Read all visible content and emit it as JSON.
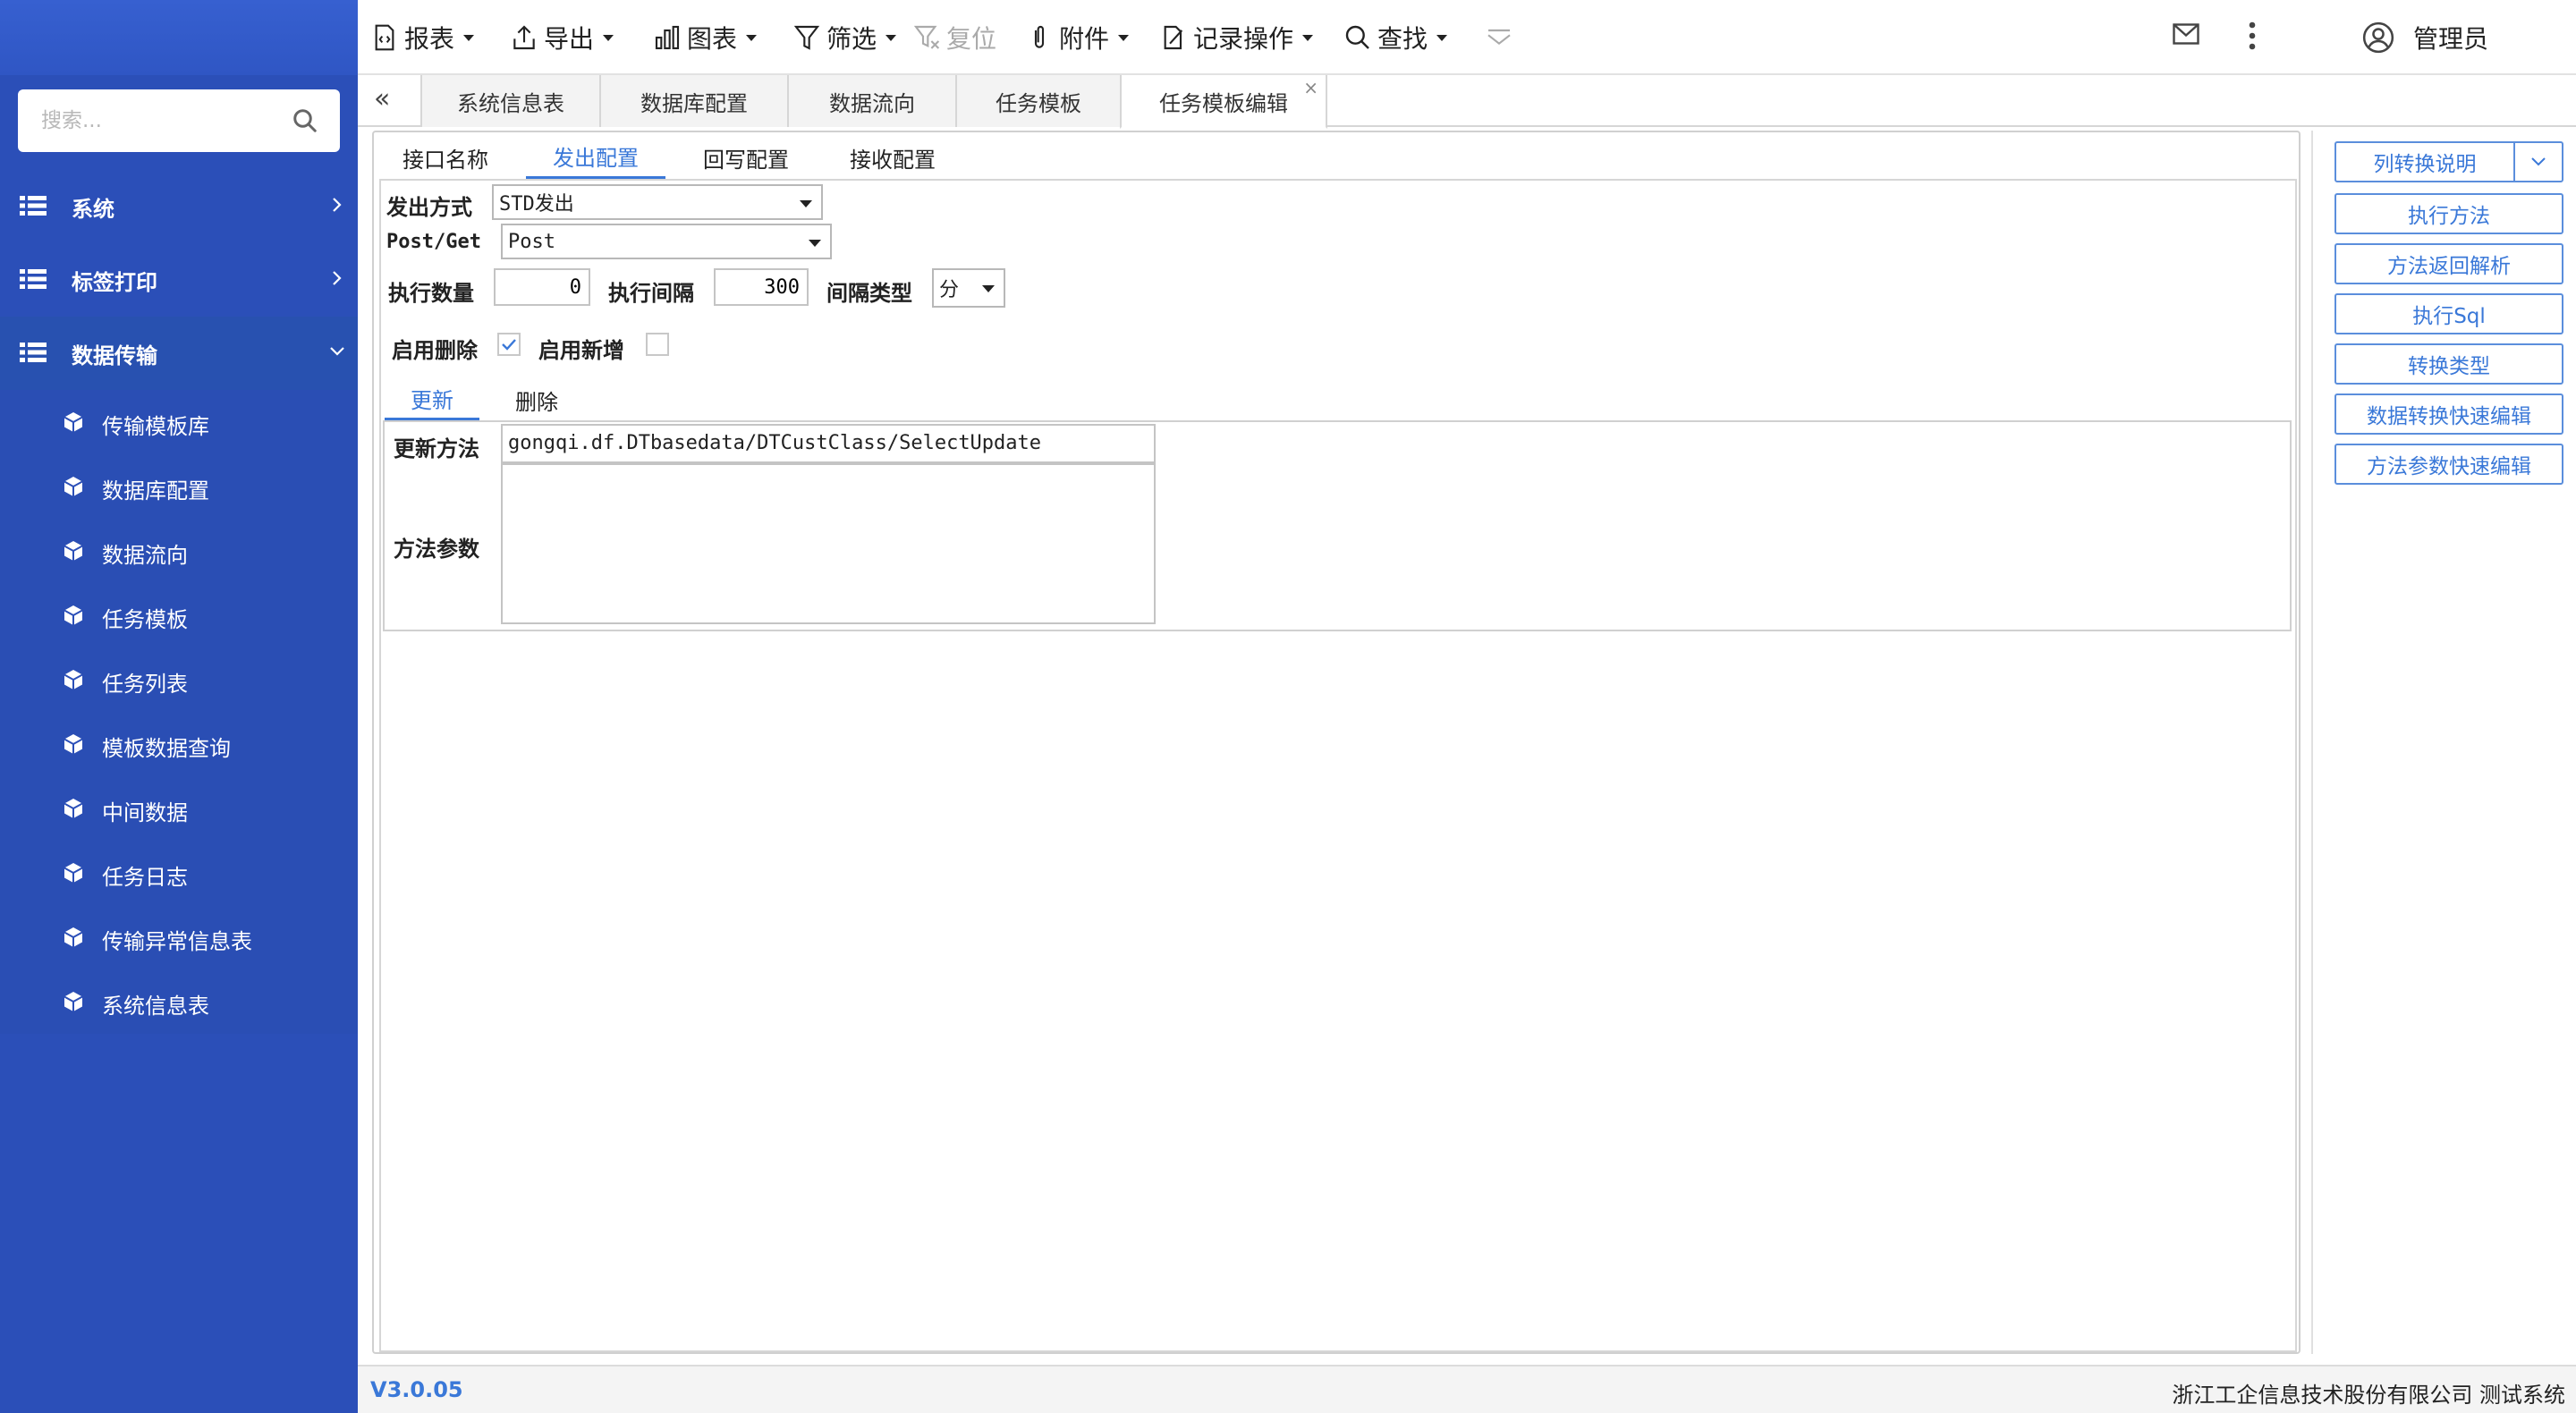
{
  "sidebar": {
    "search_placeholder": "搜索...",
    "groups": [
      {
        "label": "系统"
      },
      {
        "label": "标签打印"
      },
      {
        "label": "数据传输"
      }
    ],
    "sub_items": [
      {
        "label": "传输模板库"
      },
      {
        "label": "数据库配置"
      },
      {
        "label": "数据流向"
      },
      {
        "label": "任务模板"
      },
      {
        "label": "任务列表"
      },
      {
        "label": "模板数据查询"
      },
      {
        "label": "中间数据"
      },
      {
        "label": "任务日志"
      },
      {
        "label": "传输异常信息表"
      },
      {
        "label": "系统信息表"
      }
    ]
  },
  "toolbar": {
    "report": "报表",
    "export": "导出",
    "chart": "图表",
    "filter": "筛选",
    "reset": "复位",
    "attachment": "附件",
    "record_ops": "记录操作",
    "find": "查找",
    "user": "管理员"
  },
  "tabs": [
    {
      "label": "系统信息表"
    },
    {
      "label": "数据库配置"
    },
    {
      "label": "数据流向"
    },
    {
      "label": "任务模板"
    },
    {
      "label": "任务模板编辑"
    }
  ],
  "subtabs": [
    {
      "label": "接口名称"
    },
    {
      "label": "发出配置"
    },
    {
      "label": "回写配置"
    },
    {
      "label": "接收配置"
    }
  ],
  "form": {
    "send_mode_label": "发出方式",
    "send_mode_value": "STD发出",
    "method_label": "Post/Get",
    "method_value": "Post",
    "exec_count_label": "执行数量",
    "exec_count_value": "0",
    "exec_interval_label": "执行间隔",
    "exec_interval_value": "300",
    "interval_type_label": "间隔类型",
    "interval_type_value": "分",
    "enable_delete_label": "启用删除",
    "enable_delete_checked": true,
    "enable_add_label": "启用新增",
    "enable_add_checked": false
  },
  "inner_tabs": [
    {
      "label": "更新"
    },
    {
      "label": "删除"
    }
  ],
  "update": {
    "method_label": "更新方法",
    "method_value": "gongqi.df.DTbasedata/DTCustClass/SelectUpdate",
    "params_label": "方法参数",
    "params_value": ""
  },
  "right_buttons": [
    {
      "label": "列转换说明"
    },
    {
      "label": "执行方法"
    },
    {
      "label": "方法返回解析"
    },
    {
      "label": "执行Sql"
    },
    {
      "label": "转换类型"
    },
    {
      "label": "数据转换快速编辑"
    },
    {
      "label": "方法参数快速编辑"
    }
  ],
  "footer": {
    "version": "V3.0.05",
    "company": "浙江工企信息技术股份有限公司 测试系统"
  },
  "colors": {
    "sidebar_bg": "#2b4fb8",
    "accent": "#3a78d8"
  }
}
